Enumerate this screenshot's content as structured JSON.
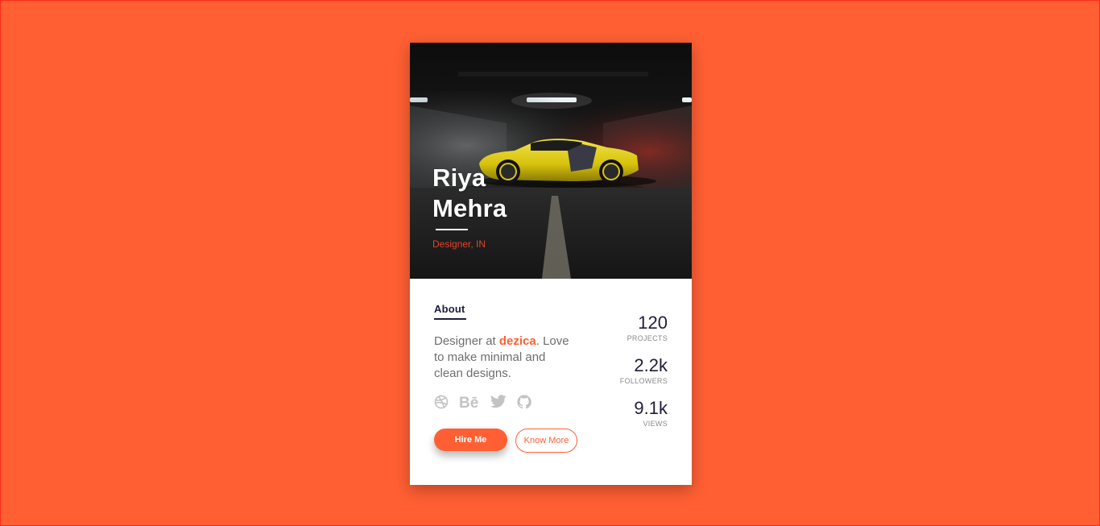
{
  "profile": {
    "first_name": "Riya",
    "last_name": "Mehra",
    "role": "Designer, IN"
  },
  "about": {
    "heading": "About",
    "text_prefix": "Designer at ",
    "company": "dezica",
    "text_suffix": ". Love to make minimal and clean designs."
  },
  "socials": [
    {
      "icon": "dribbble-icon"
    },
    {
      "icon": "behance-icon"
    },
    {
      "icon": "twitter-icon"
    },
    {
      "icon": "github-icon"
    }
  ],
  "buttons": {
    "hire_label": "Hire Me",
    "know_label": "Know More"
  },
  "stats": [
    {
      "value": "120",
      "label": "PROJECTS"
    },
    {
      "value": "2.2k",
      "label": "FOLLOWERS"
    },
    {
      "value": "9.1k",
      "label": "VIEWS"
    }
  ],
  "colors": {
    "background": "#ff5f33",
    "accent": "#ff5f33",
    "heading": "#1f1d3a",
    "role": "#e2442a"
  }
}
